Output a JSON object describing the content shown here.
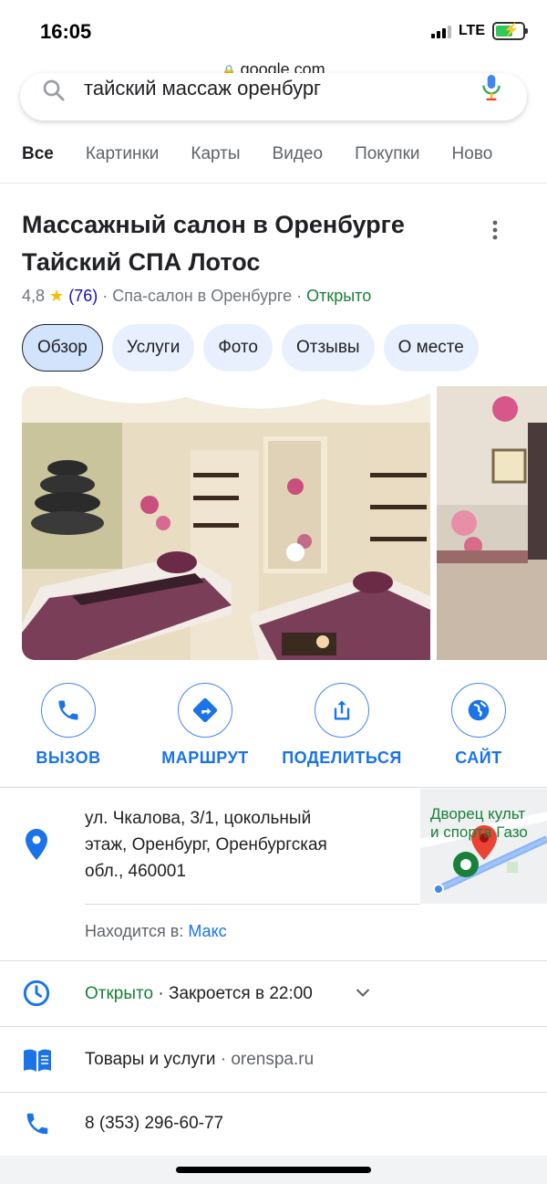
{
  "status_bar": {
    "time": "16:05",
    "network": "LTE"
  },
  "browser": {
    "url": "google.com"
  },
  "search": {
    "query": "тайский массаж оренбург"
  },
  "tabs": [
    {
      "label": "Все",
      "active": true
    },
    {
      "label": "Картинки"
    },
    {
      "label": "Карты"
    },
    {
      "label": "Видео"
    },
    {
      "label": "Покупки"
    },
    {
      "label": "Ново"
    }
  ],
  "place": {
    "title_line1": "Массажный салон в Оренбурге",
    "title_line2": "Тайский СПА Лотос",
    "rating": "4,8",
    "star": "★",
    "reviews": "(76)",
    "category": "· Спа-салон в Оренбурге ·",
    "status": "Открыто"
  },
  "chips": [
    "Обзор",
    "Услуги",
    "Фото",
    "Отзывы",
    "О месте"
  ],
  "actions": [
    {
      "label": "ВЫЗОВ",
      "icon": "phone-icon"
    },
    {
      "label": "МАРШРУТ",
      "icon": "directions-icon"
    },
    {
      "label": "ПОДЕЛИТЬСЯ",
      "icon": "share-icon"
    },
    {
      "label": "САЙТ",
      "icon": "globe-icon"
    }
  ],
  "address": {
    "line1": "ул. Чкалова, 3/1, цокольный",
    "line2": "этаж, Оренбург, Оренбургская",
    "line3": "обл., 460001",
    "map_label_1": "Дворец культ",
    "map_label_2": "и спорта Газо"
  },
  "located_in": {
    "label": "Находится в:",
    "link": "Макс"
  },
  "hours": {
    "status": "Открыто",
    "closes": "· Закроется в 22:00"
  },
  "services": {
    "label": "Товары и услуги",
    "site": "· orenspa.ru"
  },
  "phone": {
    "number": "8 (353) 296-60-77"
  },
  "colors": {
    "accent": "#1a73e8",
    "open": "#188038",
    "star": "#fbbc04",
    "chip_bg": "#e8f0fe"
  }
}
